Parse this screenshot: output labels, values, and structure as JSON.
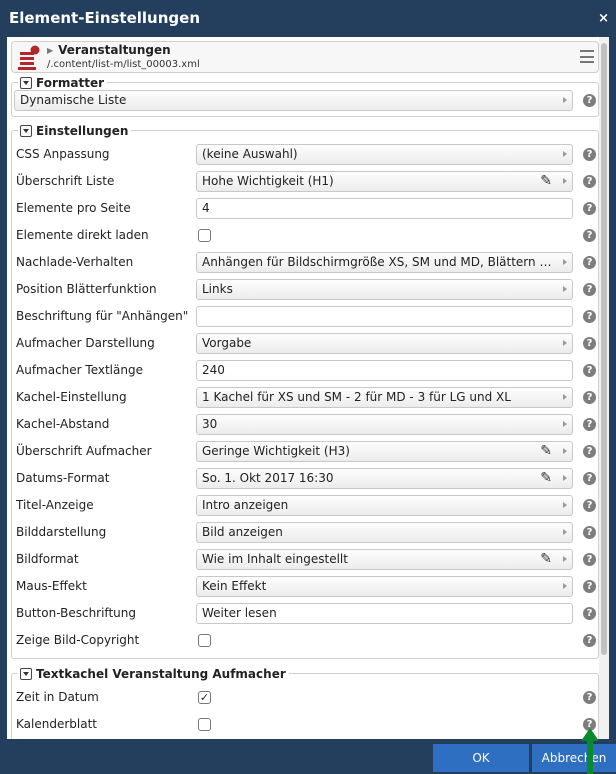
{
  "dialog": {
    "title": "Element-Einstellungen",
    "close_glyph": "×"
  },
  "resource": {
    "title": "Veranstaltungen",
    "path": "/.content/list-m/list_00003.xml",
    "icon": "list-resource-icon"
  },
  "formatter": {
    "legend": "Formatter",
    "value": "Dynamische Liste"
  },
  "settings": {
    "legend": "Einstellungen",
    "rows": [
      {
        "label": "CSS Anpassung",
        "type": "select",
        "value": "(keine Auswahl)"
      },
      {
        "label": "Überschrift Liste",
        "type": "select-pen",
        "value": "Hohe Wichtigkeit (H1)"
      },
      {
        "label": "Elemente pro Seite",
        "type": "input",
        "value": "4"
      },
      {
        "label": "Elemente direkt laden",
        "type": "checkbox",
        "checked": false
      },
      {
        "label": "Nachlade-Verhalten",
        "type": "select",
        "value": "Anhängen für Bildschirmgröße XS, SM und MD, Blättern für LG u…"
      },
      {
        "label": "Position Blätterfunktion",
        "type": "select",
        "value": "Links"
      },
      {
        "label": "Beschriftung für \"Anhängen\"",
        "type": "input",
        "value": ""
      },
      {
        "label": "Aufmacher Darstellung",
        "type": "select",
        "value": "Vorgabe"
      },
      {
        "label": "Aufmacher Textlänge",
        "type": "input",
        "value": "240"
      },
      {
        "label": "Kachel-Einstellung",
        "type": "select",
        "value": "1 Kachel für XS und SM - 2 für MD - 3 für LG und XL"
      },
      {
        "label": "Kachel-Abstand",
        "type": "select",
        "value": "30"
      },
      {
        "label": "Überschrift Aufmacher",
        "type": "select-pen",
        "value": "Geringe Wichtigkeit (H3)"
      },
      {
        "label": "Datums-Format",
        "type": "select-pen",
        "value": "So. 1. Okt 2017 16:30"
      },
      {
        "label": "Titel-Anzeige",
        "type": "select",
        "value": "Intro anzeigen"
      },
      {
        "label": "Bilddarstellung",
        "type": "select",
        "value": "Bild anzeigen"
      },
      {
        "label": "Bildformat",
        "type": "select-pen",
        "value": "Wie im Inhalt eingestellt"
      },
      {
        "label": "Maus-Effekt",
        "type": "select",
        "value": "Kein Effekt"
      },
      {
        "label": "Button-Beschriftung",
        "type": "input",
        "value": "Weiter lesen"
      },
      {
        "label": "Zeige Bild-Copyright",
        "type": "checkbox",
        "checked": false
      }
    ]
  },
  "textkachel": {
    "legend": "Textkachel Veranstaltung Aufmacher",
    "rows": [
      {
        "label": "Zeit in Datum",
        "type": "checkbox",
        "checked": true
      },
      {
        "label": "Kalenderblatt",
        "type": "checkbox",
        "checked": false
      }
    ]
  },
  "buttons": {
    "ok": "OK",
    "cancel": "Abbrechen"
  },
  "icons": {
    "help": "?",
    "pen": "✎",
    "check": "✓"
  },
  "colors": {
    "titlebar": "#233f5d",
    "button": "#2e6fc2",
    "cursor": "#0a8a2e"
  }
}
